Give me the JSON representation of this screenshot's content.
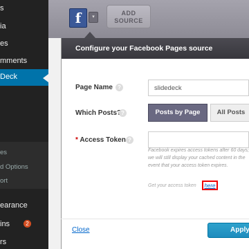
{
  "sidebar": {
    "items": [
      {
        "label": "s",
        "kind": "main"
      },
      {
        "label": "ia",
        "kind": "main"
      },
      {
        "label": "es",
        "kind": "main"
      },
      {
        "label": "mments",
        "kind": "main"
      },
      {
        "label": "Deck",
        "kind": "active"
      },
      {
        "label": "es",
        "kind": "sub"
      },
      {
        "label": "d Options",
        "kind": "sub"
      },
      {
        "label": "ort",
        "kind": "sub"
      },
      {
        "label": "earance",
        "kind": "main"
      },
      {
        "label": "ins",
        "kind": "main"
      },
      {
        "label": "rs",
        "kind": "main"
      }
    ],
    "plugins_badge": "2"
  },
  "sources": {
    "facebook_icon": "f",
    "dropdown_icon": "▾",
    "add_source_label_line1": "ADD",
    "add_source_label_line2": "SOURCE"
  },
  "modal": {
    "title": "Configure your Facebook Pages source",
    "page_name_label": "Page Name",
    "page_name_value": "slidedeck",
    "which_posts_label": "Which Posts?",
    "posts_by_page_label": "Posts by Page",
    "all_posts_label": "All Posts",
    "access_token_required": "*",
    "access_token_label": "Access Token",
    "access_token_value": "",
    "token_note": "Facebook expires access tokens after 60 days; we will still display your cached content in the event that your access token expires.",
    "get_token_text": "Get your access token",
    "here_link": "here",
    "close_label": "Close",
    "apply_label": "Apply",
    "help_icon": "?"
  },
  "colors": {
    "sidebar_bg": "#222222",
    "active_blue": "#0073aa",
    "modal_header": "#4b4a51",
    "posts_by_page_active": "#6a6982",
    "link_blue": "#0066cc",
    "highlight_red": "#ee0000"
  }
}
